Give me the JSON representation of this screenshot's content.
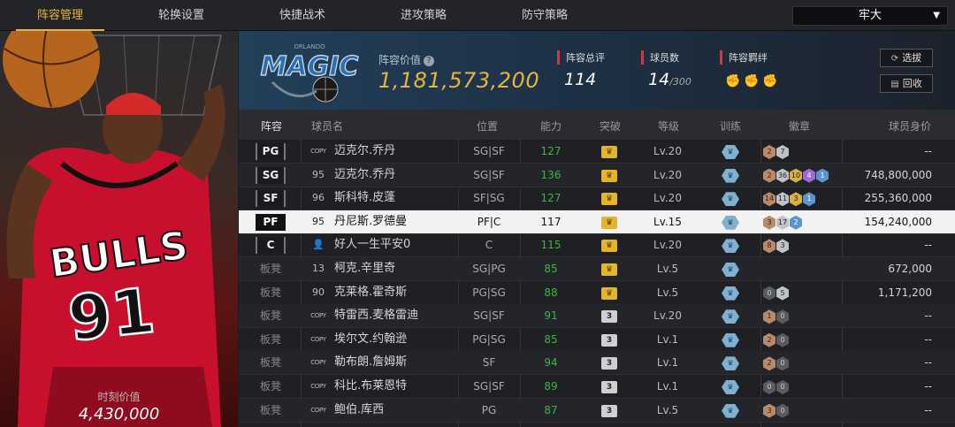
{
  "nav": {
    "tabs": [
      "阵容管理",
      "轮换设置",
      "快捷战术",
      "进攻策略",
      "防守策略"
    ],
    "active_tab": "阵容管理",
    "team_select": "牢大"
  },
  "card": {
    "jersey_text": "BULLS",
    "jersey_number": "91",
    "moment_value_label": "时刻价值",
    "moment_value": "4,430,000"
  },
  "header": {
    "logo_text": "MAGIC",
    "logo_subtext": "ORLANDO",
    "lineup_value_label": "阵容价值",
    "lineup_value": "1,181,573,200",
    "rating_label": "阵容总评",
    "rating_value": "114",
    "player_count_label": "球员数",
    "player_count_value": "14",
    "player_count_max": "/300",
    "bond_label": "阵容羁绊",
    "bond_icons": [
      "bond-icon-1",
      "bond-icon-2",
      "bond-icon-3"
    ],
    "select_button": "选拔",
    "recycle_button": "回收"
  },
  "table": {
    "columns": [
      "阵容",
      "球员名",
      "位置",
      "能力",
      "突破",
      "等级",
      "训练",
      "徽章",
      "球员身价"
    ],
    "rows": [
      {
        "slot": "PG",
        "num": "COPY",
        "name": "迈克尔.乔丹",
        "pos": "SG|SF",
        "ability": "127",
        "breakthrough": "gold",
        "level": "Lv.20",
        "badges": [
          {
            "t": "b",
            "v": "2"
          },
          {
            "t": "s",
            "v": "7"
          }
        ],
        "value": "--"
      },
      {
        "slot": "SG",
        "num": "95",
        "name": "迈克尔.乔丹",
        "pos": "SG|SF",
        "ability": "136",
        "breakthrough": "gold",
        "level": "Lv.20",
        "badges": [
          {
            "t": "b",
            "v": "2"
          },
          {
            "t": "s",
            "v": "36"
          },
          {
            "t": "g",
            "v": "10"
          },
          {
            "t": "p",
            "v": "4"
          },
          {
            "t": "bl",
            "v": "1"
          }
        ],
        "value": "748,800,000"
      },
      {
        "slot": "SF",
        "num": "96",
        "name": "斯科特.皮蓬",
        "pos": "SF|SG",
        "ability": "127",
        "breakthrough": "gold",
        "level": "Lv.20",
        "badges": [
          {
            "t": "b",
            "v": "14"
          },
          {
            "t": "s",
            "v": "11"
          },
          {
            "t": "g",
            "v": "3"
          },
          {
            "t": "bl",
            "v": "1"
          }
        ],
        "value": "255,360,000"
      },
      {
        "slot": "PF",
        "num": "95",
        "name": "丹尼斯.罗德曼",
        "pos": "PF|C",
        "ability": "117",
        "breakthrough": "gold",
        "level": "Lv.15",
        "badges": [
          {
            "t": "b",
            "v": "3"
          },
          {
            "t": "s",
            "v": "17"
          },
          {
            "t": "bl",
            "v": "2"
          }
        ],
        "value": "154,240,000"
      },
      {
        "slot": "C",
        "num": "👤",
        "name": "好人一生平安0",
        "pos": "C",
        "ability": "115",
        "breakthrough": "gold",
        "level": "Lv.20",
        "badges": [
          {
            "t": "b",
            "v": "8"
          },
          {
            "t": "s",
            "v": "3"
          }
        ],
        "value": "--"
      },
      {
        "slot": "板凳",
        "num": "13",
        "name": "柯克.辛里奇",
        "pos": "SG|PG",
        "ability": "85",
        "breakthrough": "gold",
        "level": "Lv.5",
        "badges": [],
        "value": "672,000"
      },
      {
        "slot": "板凳",
        "num": "90",
        "name": "克莱格.霍奇斯",
        "pos": "PG|SG",
        "ability": "88",
        "breakthrough": "gold",
        "level": "Lv.5",
        "badges": [
          {
            "t": "d",
            "v": "0"
          },
          {
            "t": "s",
            "v": "5"
          }
        ],
        "value": "1,171,200"
      },
      {
        "slot": "板凳",
        "num": "COPY",
        "name": "特雷西.麦格雷迪",
        "pos": "SG|SF",
        "ability": "91",
        "breakthrough": "3",
        "level": "Lv.20",
        "badges": [
          {
            "t": "b",
            "v": "1"
          },
          {
            "t": "d",
            "v": "0"
          }
        ],
        "value": "--"
      },
      {
        "slot": "板凳",
        "num": "COPY",
        "name": "埃尔文.约翰逊",
        "pos": "PG|SG",
        "ability": "85",
        "breakthrough": "3",
        "level": "Lv.1",
        "badges": [
          {
            "t": "b",
            "v": "2"
          },
          {
            "t": "d",
            "v": "0"
          }
        ],
        "value": "--"
      },
      {
        "slot": "板凳",
        "num": "COPY",
        "name": "勒布朗.詹姆斯",
        "pos": "SF",
        "ability": "94",
        "breakthrough": "3",
        "level": "Lv.1",
        "badges": [
          {
            "t": "b",
            "v": "2"
          },
          {
            "t": "d",
            "v": "0"
          }
        ],
        "value": "--"
      },
      {
        "slot": "板凳",
        "num": "COPY",
        "name": "科比.布莱恩特",
        "pos": "SG|SF",
        "ability": "89",
        "breakthrough": "3",
        "level": "Lv.1",
        "badges": [
          {
            "t": "d",
            "v": "0"
          },
          {
            "t": "d",
            "v": "0"
          }
        ],
        "value": "--"
      },
      {
        "slot": "板凳",
        "num": "COPY",
        "name": "鲍伯.库西",
        "pos": "PG",
        "ability": "87",
        "breakthrough": "3",
        "level": "Lv.5",
        "badges": [
          {
            "t": "b",
            "v": "3"
          },
          {
            "t": "d",
            "v": "0"
          }
        ],
        "value": "--"
      }
    ]
  },
  "colors": {
    "accent": "#e6b43c",
    "ability_green": "#3fb340",
    "bulls_red": "#c8102e"
  }
}
